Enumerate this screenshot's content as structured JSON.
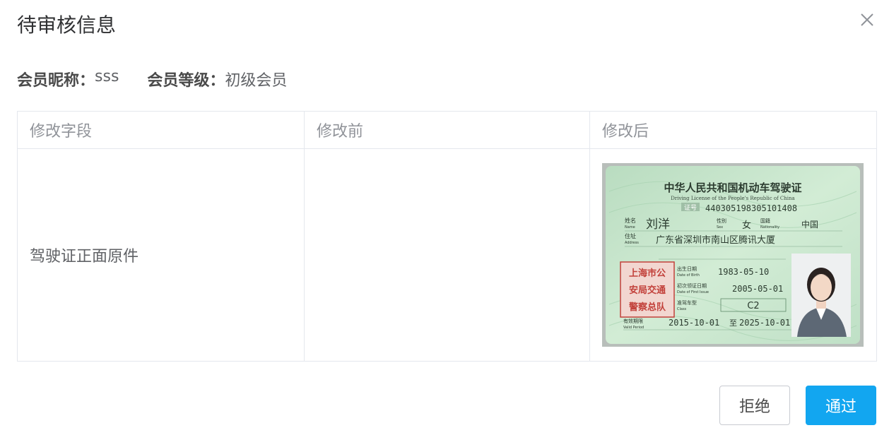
{
  "dialog": {
    "title": "待审核信息",
    "close_icon": "close-icon"
  },
  "member": {
    "nickname_label": "会员昵称：",
    "nickname_value": "sss",
    "level_label": "会员等级：",
    "level_value": "初级会员"
  },
  "table": {
    "headers": [
      "修改字段",
      "修改前",
      "修改后"
    ],
    "rows": [
      {
        "field": "驾驶证正面原件",
        "before": "",
        "after_image": "driver-license-photo"
      }
    ]
  },
  "license": {
    "title": "中华人民共和国机动车驾驶证",
    "subtitle": "Driving License of the People's Republic of China",
    "cert_label": "证号",
    "number": "440305198305101408",
    "name_label": "姓名",
    "name_label_en": "Name",
    "name": "刘洋",
    "sex_label": "性别",
    "sex_label_en": "Sex",
    "sex": "女",
    "nationality_label": "国籍",
    "nationality_label_en": "Nationality",
    "nationality": "中国",
    "address_label": "住址",
    "address_label_en": "Address",
    "address": "广东省深圳市南山区腾讯大厦",
    "birth_label": "出生日期",
    "birth_label_en": "Date of Birth",
    "birth": "1983-05-10",
    "first_issue_label": "初次领证日期",
    "first_issue_label_en": "Date of First Issue",
    "first_issue": "2005-05-01",
    "class_label": "准驾车型",
    "class_label_en": "Class",
    "class": "C2",
    "valid_label": "有效期限",
    "valid_label_en": "Valid Period",
    "valid_from": "2015-10-01",
    "valid_to_word": "至",
    "valid_to": "2025-10-01",
    "stamp_line1": "上海市公",
    "stamp_line2": "安局交通",
    "stamp_line3": "警察总队"
  },
  "actions": {
    "reject_label": "拒绝",
    "approve_label": "通过"
  },
  "colors": {
    "primary": "#12a6f0",
    "border": "#e4e7ed",
    "license_green": "#c4e6c9"
  }
}
